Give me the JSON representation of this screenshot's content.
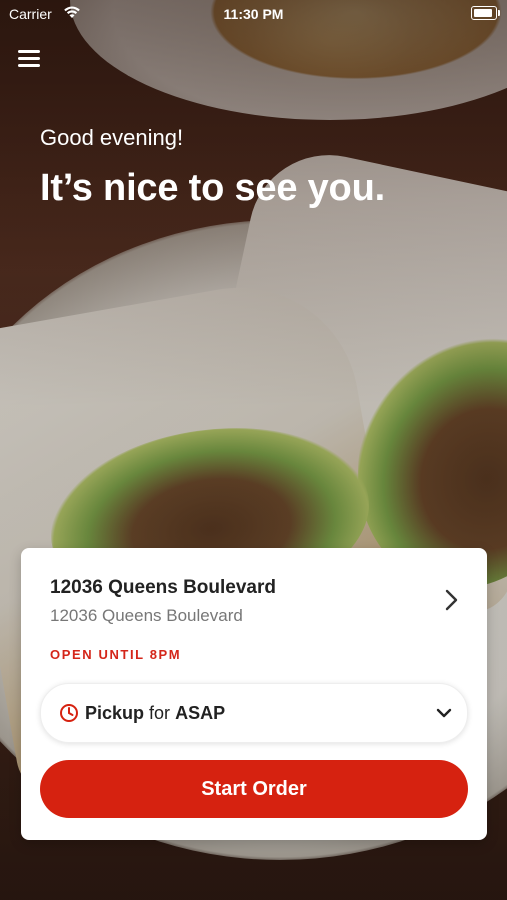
{
  "status_bar": {
    "carrier": "Carrier",
    "time": "11:30 PM"
  },
  "hero": {
    "greeting": "Good evening!",
    "headline": "It’s nice to see you."
  },
  "location": {
    "name": "12036 Queens Boulevard",
    "address": "12036 Queens Boulevard",
    "hours": "OPEN UNTIL 8PM"
  },
  "order_mode": {
    "mode": "Pickup",
    "connector": "for",
    "time": "ASAP"
  },
  "start_button": {
    "label": "Start Order"
  },
  "colors": {
    "accent": "#d62210",
    "hours_text": "#d4261a"
  },
  "icons": [
    "wifi-icon",
    "battery-icon",
    "hamburger-menu-icon",
    "chevron-right-icon",
    "clock-icon",
    "chevron-down-icon"
  ]
}
